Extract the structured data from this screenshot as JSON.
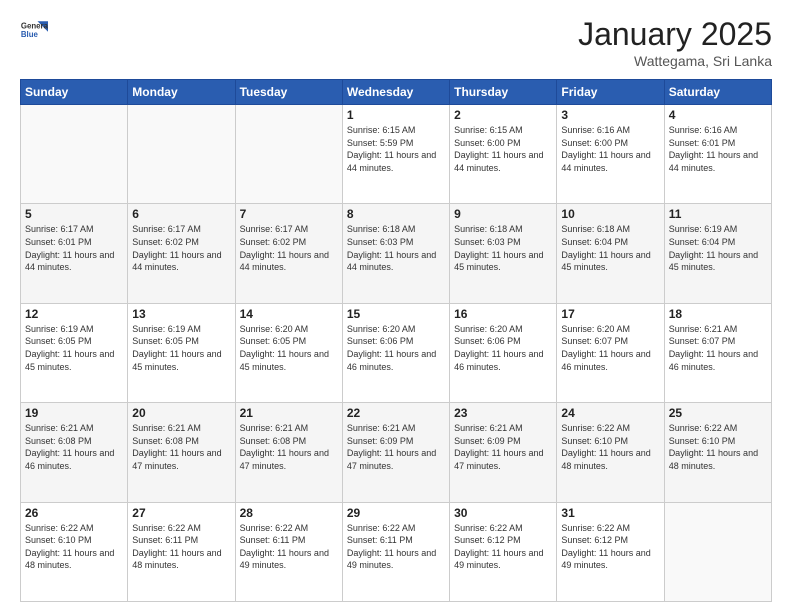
{
  "header": {
    "logo_general": "General",
    "logo_blue": "Blue",
    "month_title": "January 2025",
    "location": "Wattegama, Sri Lanka"
  },
  "weekdays": [
    "Sunday",
    "Monday",
    "Tuesday",
    "Wednesday",
    "Thursday",
    "Friday",
    "Saturday"
  ],
  "weeks": [
    {
      "days": [
        {
          "num": "",
          "empty": true
        },
        {
          "num": "",
          "empty": true
        },
        {
          "num": "",
          "empty": true
        },
        {
          "num": "1",
          "sunrise": "6:15 AM",
          "sunset": "5:59 PM",
          "daylight": "11 hours and 44 minutes."
        },
        {
          "num": "2",
          "sunrise": "6:15 AM",
          "sunset": "6:00 PM",
          "daylight": "11 hours and 44 minutes."
        },
        {
          "num": "3",
          "sunrise": "6:16 AM",
          "sunset": "6:00 PM",
          "daylight": "11 hours and 44 minutes."
        },
        {
          "num": "4",
          "sunrise": "6:16 AM",
          "sunset": "6:01 PM",
          "daylight": "11 hours and 44 minutes."
        }
      ]
    },
    {
      "days": [
        {
          "num": "5",
          "sunrise": "6:17 AM",
          "sunset": "6:01 PM",
          "daylight": "11 hours and 44 minutes."
        },
        {
          "num": "6",
          "sunrise": "6:17 AM",
          "sunset": "6:02 PM",
          "daylight": "11 hours and 44 minutes."
        },
        {
          "num": "7",
          "sunrise": "6:17 AM",
          "sunset": "6:02 PM",
          "daylight": "11 hours and 44 minutes."
        },
        {
          "num": "8",
          "sunrise": "6:18 AM",
          "sunset": "6:03 PM",
          "daylight": "11 hours and 44 minutes."
        },
        {
          "num": "9",
          "sunrise": "6:18 AM",
          "sunset": "6:03 PM",
          "daylight": "11 hours and 45 minutes."
        },
        {
          "num": "10",
          "sunrise": "6:18 AM",
          "sunset": "6:04 PM",
          "daylight": "11 hours and 45 minutes."
        },
        {
          "num": "11",
          "sunrise": "6:19 AM",
          "sunset": "6:04 PM",
          "daylight": "11 hours and 45 minutes."
        }
      ]
    },
    {
      "days": [
        {
          "num": "12",
          "sunrise": "6:19 AM",
          "sunset": "6:05 PM",
          "daylight": "11 hours and 45 minutes."
        },
        {
          "num": "13",
          "sunrise": "6:19 AM",
          "sunset": "6:05 PM",
          "daylight": "11 hours and 45 minutes."
        },
        {
          "num": "14",
          "sunrise": "6:20 AM",
          "sunset": "6:05 PM",
          "daylight": "11 hours and 45 minutes."
        },
        {
          "num": "15",
          "sunrise": "6:20 AM",
          "sunset": "6:06 PM",
          "daylight": "11 hours and 46 minutes."
        },
        {
          "num": "16",
          "sunrise": "6:20 AM",
          "sunset": "6:06 PM",
          "daylight": "11 hours and 46 minutes."
        },
        {
          "num": "17",
          "sunrise": "6:20 AM",
          "sunset": "6:07 PM",
          "daylight": "11 hours and 46 minutes."
        },
        {
          "num": "18",
          "sunrise": "6:21 AM",
          "sunset": "6:07 PM",
          "daylight": "11 hours and 46 minutes."
        }
      ]
    },
    {
      "days": [
        {
          "num": "19",
          "sunrise": "6:21 AM",
          "sunset": "6:08 PM",
          "daylight": "11 hours and 46 minutes."
        },
        {
          "num": "20",
          "sunrise": "6:21 AM",
          "sunset": "6:08 PM",
          "daylight": "11 hours and 47 minutes."
        },
        {
          "num": "21",
          "sunrise": "6:21 AM",
          "sunset": "6:08 PM",
          "daylight": "11 hours and 47 minutes."
        },
        {
          "num": "22",
          "sunrise": "6:21 AM",
          "sunset": "6:09 PM",
          "daylight": "11 hours and 47 minutes."
        },
        {
          "num": "23",
          "sunrise": "6:21 AM",
          "sunset": "6:09 PM",
          "daylight": "11 hours and 47 minutes."
        },
        {
          "num": "24",
          "sunrise": "6:22 AM",
          "sunset": "6:10 PM",
          "daylight": "11 hours and 48 minutes."
        },
        {
          "num": "25",
          "sunrise": "6:22 AM",
          "sunset": "6:10 PM",
          "daylight": "11 hours and 48 minutes."
        }
      ]
    },
    {
      "days": [
        {
          "num": "26",
          "sunrise": "6:22 AM",
          "sunset": "6:10 PM",
          "daylight": "11 hours and 48 minutes."
        },
        {
          "num": "27",
          "sunrise": "6:22 AM",
          "sunset": "6:11 PM",
          "daylight": "11 hours and 48 minutes."
        },
        {
          "num": "28",
          "sunrise": "6:22 AM",
          "sunset": "6:11 PM",
          "daylight": "11 hours and 49 minutes."
        },
        {
          "num": "29",
          "sunrise": "6:22 AM",
          "sunset": "6:11 PM",
          "daylight": "11 hours and 49 minutes."
        },
        {
          "num": "30",
          "sunrise": "6:22 AM",
          "sunset": "6:12 PM",
          "daylight": "11 hours and 49 minutes."
        },
        {
          "num": "31",
          "sunrise": "6:22 AM",
          "sunset": "6:12 PM",
          "daylight": "11 hours and 49 minutes."
        },
        {
          "num": "",
          "empty": true
        }
      ]
    }
  ],
  "labels": {
    "sunrise": "Sunrise:",
    "sunset": "Sunset:",
    "daylight": "Daylight:"
  }
}
